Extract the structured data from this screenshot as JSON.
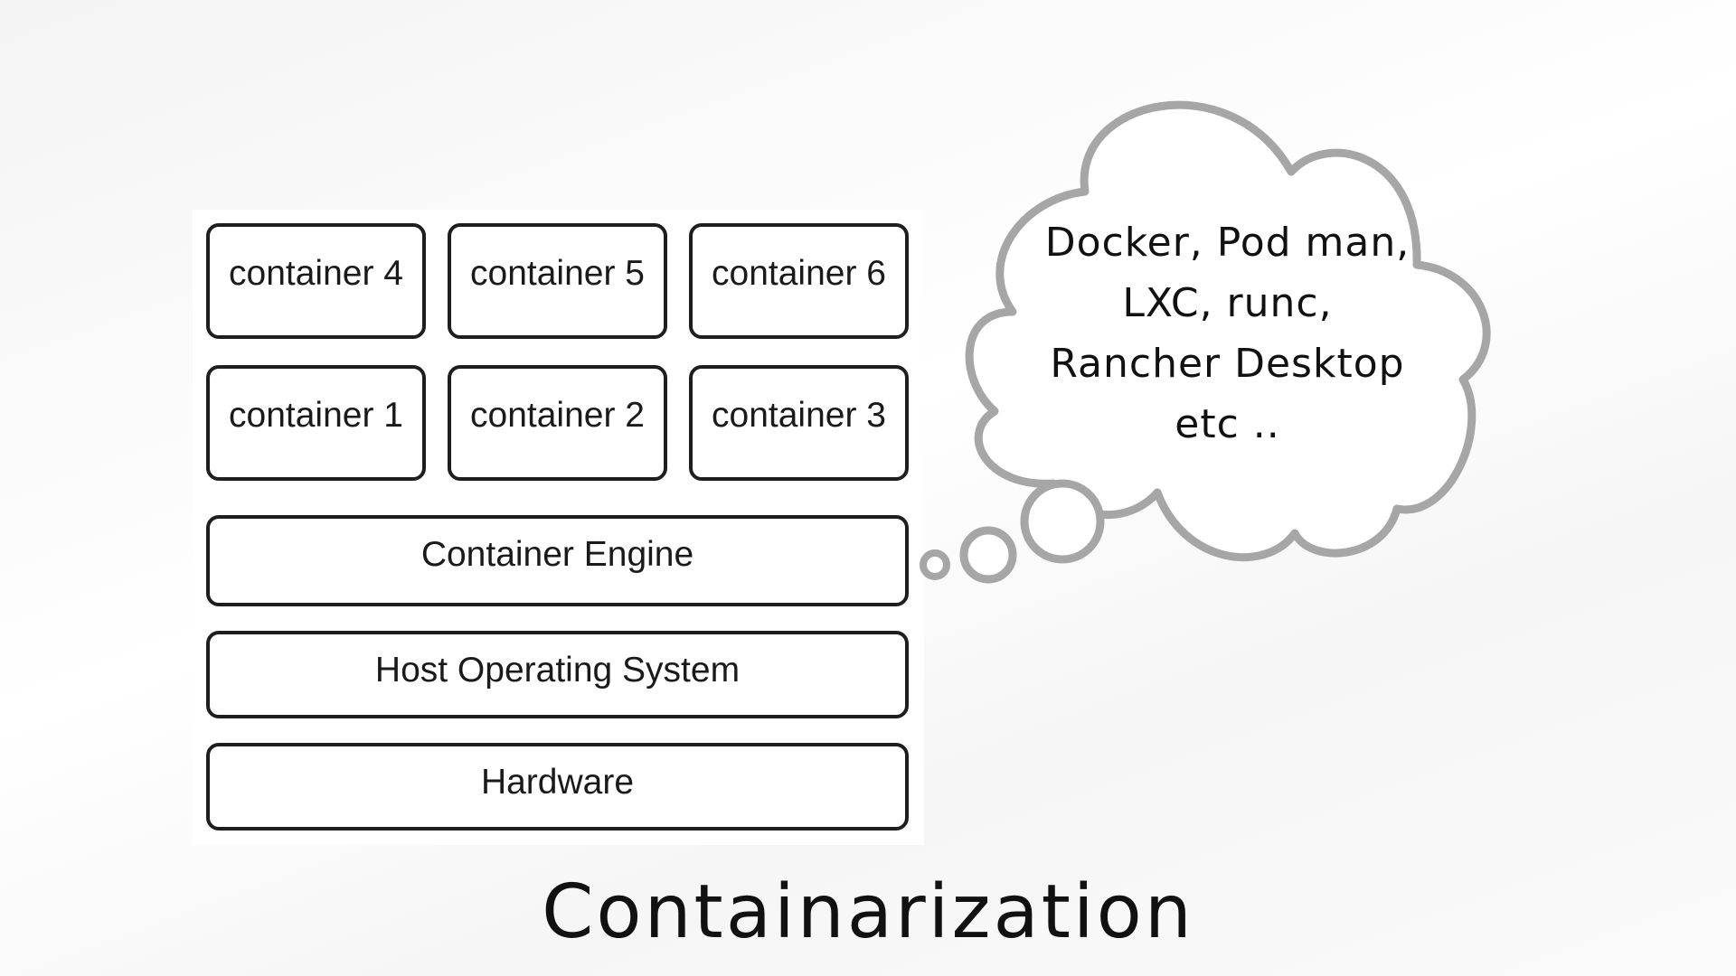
{
  "diagram": {
    "title": "Containarization",
    "containers_top_row": [
      "container 4",
      "container 5",
      "container 6"
    ],
    "containers_bottom_row": [
      "container 1",
      "container 2",
      "container 3"
    ],
    "layers": {
      "engine": "Container Engine",
      "os": "Host Operating System",
      "hardware": "Hardware"
    },
    "thought_bubble": {
      "lines": [
        "Docker, Pod man,",
        "LXC, runc,",
        "Rancher Desktop",
        "etc .."
      ]
    }
  },
  "colors": {
    "box_stroke": "#1e1e1e",
    "cloud_stroke": "#a6a6a6",
    "text": "#111111"
  }
}
